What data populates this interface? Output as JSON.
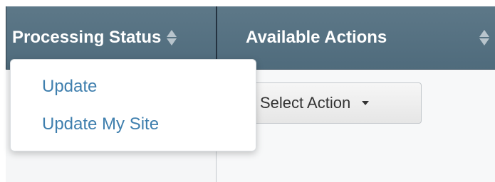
{
  "table": {
    "columns": [
      {
        "label": "Processing Status",
        "sortable": true
      },
      {
        "label": "Available Actions",
        "sortable": true
      }
    ]
  },
  "dropdown": {
    "items": [
      "Update",
      "Update My Site"
    ]
  },
  "select_action": {
    "label": "Select Action"
  },
  "colors": {
    "header_bg": "#566f80",
    "link": "#3f7fae",
    "header_text": "#ffffff"
  },
  "icons": {
    "sort": "sort-arrows-icon",
    "caret": "caret-down-icon"
  }
}
